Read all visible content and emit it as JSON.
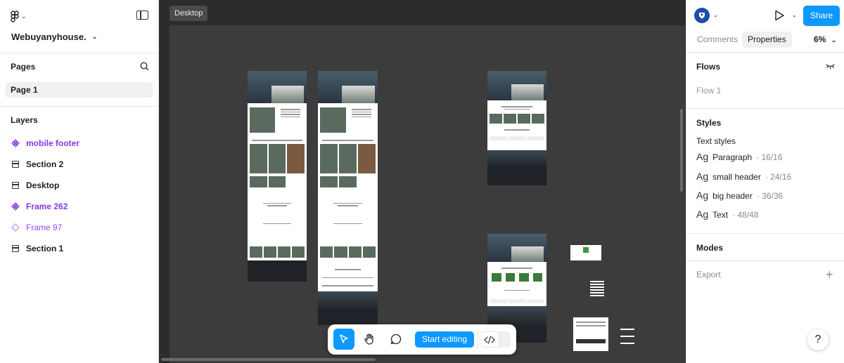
{
  "file": {
    "name": "Webuyanyhouse."
  },
  "pages": {
    "title": "Pages",
    "items": [
      {
        "label": "Page 1"
      }
    ]
  },
  "layers": {
    "title": "Layers",
    "items": [
      {
        "label": "mobile footer",
        "kind": "component"
      },
      {
        "label": "Section 2",
        "kind": "frame"
      },
      {
        "label": "Desktop",
        "kind": "frame"
      },
      {
        "label": "Frame 262",
        "kind": "component"
      },
      {
        "label": "Frame 97",
        "kind": "instance"
      },
      {
        "label": "Section 1",
        "kind": "frame"
      }
    ]
  },
  "canvas": {
    "selected_label": "Desktop"
  },
  "toolbar": {
    "start_editing": "Start editing"
  },
  "header": {
    "share_label": "Share",
    "zoom": "6%"
  },
  "tabs": [
    {
      "label": "Comments"
    },
    {
      "label": "Properties"
    }
  ],
  "flows": {
    "title": "Flows",
    "items": [
      "Flow 1"
    ]
  },
  "styles": {
    "title": "Styles",
    "text_styles_title": "Text styles",
    "items": [
      {
        "glyph": "Ag",
        "name": "Paragraph",
        "size": "· 16/16"
      },
      {
        "glyph": "Ag",
        "name": "small header",
        "size": "· 24/16"
      },
      {
        "glyph": "Ag",
        "name": "big header",
        "size": "· 36/36"
      },
      {
        "glyph": "Ag",
        "name": "Text",
        "size": "· 48/48"
      }
    ]
  },
  "modes": {
    "title": "Modes"
  },
  "export": {
    "title": "Export"
  },
  "help": {
    "label": "?"
  },
  "colors": {
    "accent": "#0d99ff",
    "component": "#8638e5",
    "canvas": "#2c2c2c"
  }
}
